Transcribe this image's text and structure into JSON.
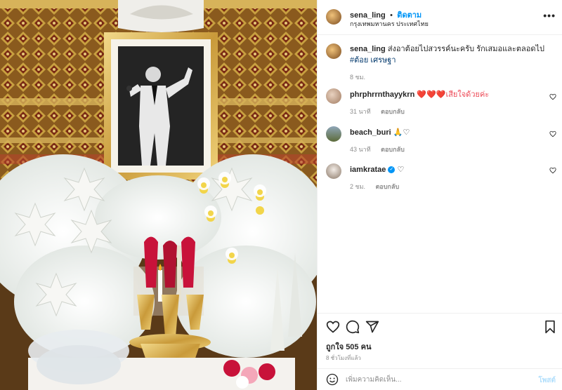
{
  "post": {
    "username": "sena_ling",
    "separator": "•",
    "follow_label": "ติดตาม",
    "location": "กรุงเทพมหานคร ประเทศไทย",
    "more_icon": "more-icon",
    "caption_text": "ส่งอาต้อยไปสวรรค์นะครับ รักเสมอและตลอดไป",
    "caption_tag": "#ต้อย เศรษฐา",
    "caption_time": "8 ชม."
  },
  "comments": [
    {
      "username": "phrphrrnthayykrn",
      "text": "❤️❤️❤️เสียใจด้วยค่ะ",
      "time": "31 นาที",
      "reply": "ตอบกลับ"
    },
    {
      "username": "beach_buri",
      "text": "🙏♡",
      "time": "43 นาที",
      "reply": "ตอบกลับ"
    },
    {
      "username": "iamkratae",
      "text": "♡",
      "time": "2 ชม.",
      "reply": "ตอบกลับ"
    }
  ],
  "actions": {
    "like_icon": "heart-icon",
    "comment_icon": "comment-icon",
    "share_icon": "share-icon",
    "save_icon": "bookmark-icon",
    "likes_text": "ถูกใจ 505 คน",
    "post_time": "8 ชั่วโมงที่แล้ว"
  },
  "add_comment": {
    "placeholder": "เพิ่มความคิดเห็น...",
    "post_label": "โพสต์",
    "emoji_icon": "emoji-icon"
  },
  "colors": {
    "accent": "#0095f6",
    "verified": "#0095f6",
    "heart_red": "#ed4956",
    "muted": "#8e8e8e",
    "tag": "#00376b"
  }
}
